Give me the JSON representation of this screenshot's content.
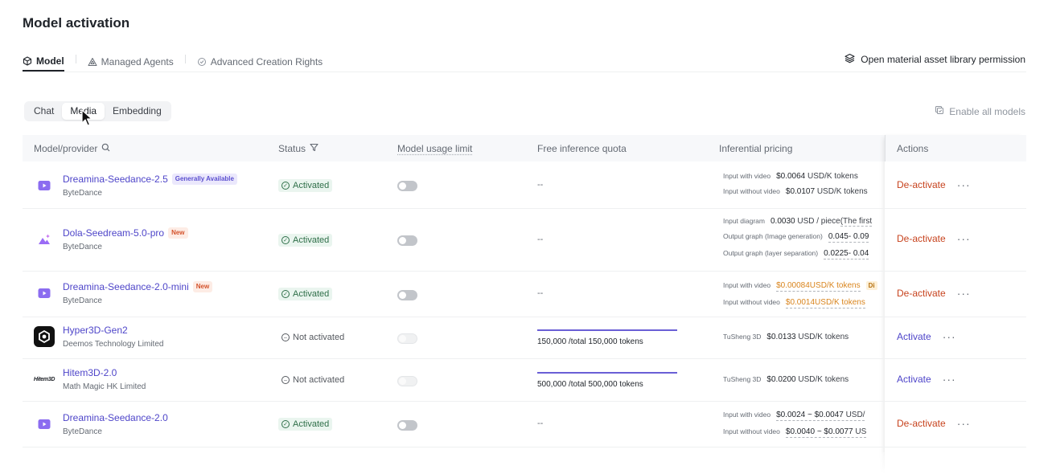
{
  "page": {
    "title": "Model activation"
  },
  "top_tabs": [
    {
      "label": "Model",
      "icon": "cube-icon",
      "active": true
    },
    {
      "label": "Managed Agents",
      "icon": "triangle-icon",
      "active": false
    },
    {
      "label": "Advanced Creation Rights",
      "icon": "badge-icon",
      "active": false
    }
  ],
  "open_permission": {
    "label": "Open material asset library permission",
    "icon": "layers-icon"
  },
  "segments": [
    {
      "label": "Chat",
      "active": false
    },
    {
      "label": "Media",
      "active": true
    },
    {
      "label": "Embedding",
      "active": false
    }
  ],
  "enable_all": {
    "label": "Enable all models",
    "icon": "enable-models-icon"
  },
  "table": {
    "headers": {
      "model": "Model/provider",
      "status": "Status",
      "usage_limit": "Model usage limit",
      "quota": "Free inference quota",
      "pricing": "Inferential pricing",
      "actions": "Actions"
    },
    "rows": [
      {
        "name": "Dreamina-Seedance-2.5",
        "badge": "Generally Available",
        "provider": "ByteDance",
        "status": "Activated",
        "quota": "--",
        "pricing": [
          {
            "label": "Input with video",
            "value": "$0.0064",
            "unit": "USD/K tokens"
          },
          {
            "label": "Input without video",
            "value": "$0.0107",
            "unit": "USD/K tokens"
          }
        ],
        "action": "De-activate"
      },
      {
        "name": "Dola-Seedream-5.0-pro",
        "badge": "New",
        "provider": "ByteDance",
        "status": "Activated",
        "quota": "--",
        "pricing": [
          {
            "label": "Input diagram",
            "value": "0.0030",
            "unit": "USD / piece",
            "extra": "(The first"
          },
          {
            "label": "Output graph (Image generation)",
            "value": "0.045- 0.09"
          },
          {
            "label": "Output graph (layer separation)",
            "value": "0.0225- 0.04"
          }
        ],
        "action": "De-activate"
      },
      {
        "name": "Dreamina-Seedance-2.0-mini",
        "badge": "New",
        "provider": "ByteDance",
        "status": "Activated",
        "quota": "--",
        "pricing": [
          {
            "label": "Input with video",
            "value": "$0.00084",
            "unit": "USD/K tokens",
            "tag": "Di"
          },
          {
            "label": "Input without video",
            "value": "$0.0014",
            "unit": "USD/K tokens"
          }
        ],
        "action": "De-activate"
      },
      {
        "name": "Hyper3D-Gen2",
        "provider": "Deemos Technology Limited",
        "status": "Not activated",
        "quota_text": "150,000 /total 150,000 tokens",
        "quota_used_fraction": 1.0,
        "pricing": [
          {
            "label": "TuSheng 3D",
            "value": "$0.0133",
            "unit": "USD/K tokens"
          }
        ],
        "action": "Activate"
      },
      {
        "name": "Hitem3D-2.0",
        "logo_text": "Hitem3D",
        "provider": "Math Magic HK Limited",
        "status": "Not activated",
        "quota_text": "500,000 /total 500,000 tokens",
        "quota_used_fraction": 1.0,
        "pricing": [
          {
            "label": "TuSheng 3D",
            "value": "$0.0200",
            "unit": "USD/K tokens"
          }
        ],
        "action": "Activate"
      },
      {
        "name": "Dreamina-Seedance-2.0",
        "provider": "ByteDance",
        "status": "Activated",
        "quota": "--",
        "pricing": [
          {
            "label": "Input with video",
            "value": "$0.0024 ~ $0.0047",
            "unit": "USD/"
          },
          {
            "label": "Input without video",
            "value": "$0.0040 ~ $0.0077",
            "unit": "US"
          }
        ],
        "action": "De-activate"
      }
    ]
  },
  "colors": {
    "accent": "#4e45c9",
    "deactivate": "#c7431e",
    "activated_bg": "#eaf5ef",
    "activated_text": "#2f6f49",
    "price_orange": "#d9841c"
  }
}
